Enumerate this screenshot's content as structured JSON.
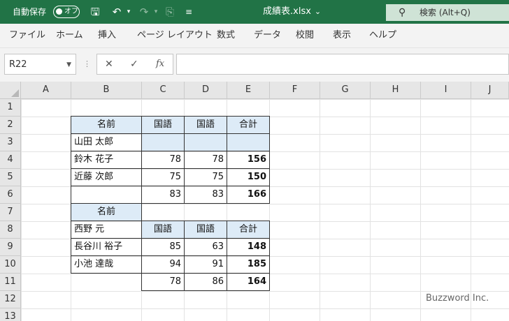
{
  "titlebar": {
    "autosave_label": "自動保存",
    "autosave_state": "オフ",
    "filename": "成績表.xlsx",
    "search_placeholder": "検索 (Alt+Q)",
    "colors": {
      "bar": "#217346",
      "search": "#cfe3d6"
    }
  },
  "menu": {
    "items": [
      "ファイル",
      "ホーム",
      "挿入",
      "ページ レイアウト",
      "数式",
      "データ",
      "校閲",
      "表示",
      "ヘルプ"
    ]
  },
  "formula_bar": {
    "name_box": "R22",
    "cancel_glyph": "✕",
    "enter_glyph": "✓",
    "fx_label": "fx",
    "formula": ""
  },
  "grid": {
    "columns": [
      "A",
      "B",
      "C",
      "D",
      "E",
      "F",
      "G",
      "H",
      "I",
      "J"
    ],
    "rows": [
      "1",
      "2",
      "3",
      "4",
      "5",
      "6",
      "7",
      "8",
      "9",
      "10",
      "11",
      "12",
      "13"
    ],
    "highlight_color": "#ddebf7",
    "cells": {
      "B2": "名前",
      "C2": "国語",
      "D2": "国語",
      "E2": "合計",
      "B3": "山田 太郎",
      "C3": "",
      "D3": "",
      "E3": "",
      "B4": "鈴木 花子",
      "C4": "78",
      "D4": "78",
      "E4": "156",
      "B5": "近藤 次郎",
      "C5": "75",
      "D5": "75",
      "E5": "150",
      "B6": "",
      "C6": "83",
      "D6": "83",
      "E6": "166",
      "B7": "名前",
      "B8": "西野 元",
      "C8": "国語",
      "D8": "国語",
      "E8": "合計",
      "B9": "長谷川 裕子",
      "C9": "85",
      "D9": "63",
      "E9": "148",
      "B10": "小池 達哉",
      "C10": "94",
      "D10": "91",
      "E10": "185",
      "C11": "78",
      "D11": "86",
      "E11": "164"
    }
  },
  "watermark": "Buzzword Inc."
}
